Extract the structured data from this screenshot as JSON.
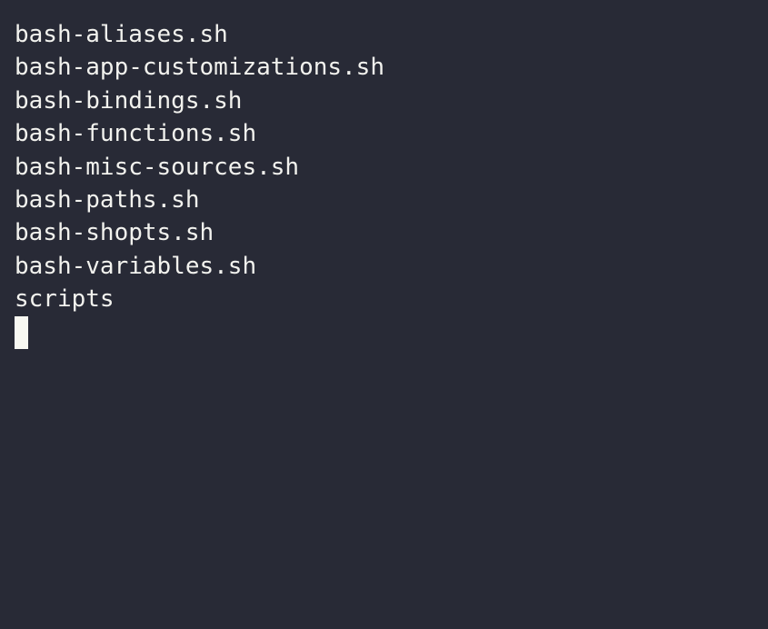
{
  "terminal": {
    "background_color": "#282a36",
    "foreground_color": "#f2f2ee",
    "cursor_color": "#f8f8f2",
    "output_lines": [
      "bash-aliases.sh",
      "bash-app-customizations.sh",
      "bash-bindings.sh",
      "bash-functions.sh",
      "bash-misc-sources.sh",
      "bash-paths.sh",
      "bash-shopts.sh",
      "bash-variables.sh",
      "scripts"
    ],
    "cursor": "block-cursor"
  }
}
